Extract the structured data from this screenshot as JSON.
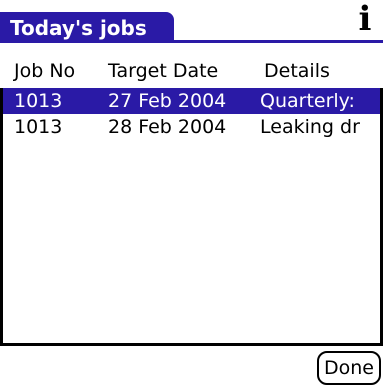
{
  "header": {
    "title": "Today's jobs",
    "info_icon": "info-icon",
    "info_glyph": "i",
    "accent_color": "#2a1aa6"
  },
  "table": {
    "columns": [
      "Job No",
      "Target Date",
      "Details"
    ],
    "rows": [
      {
        "job_no": "1013",
        "target_date": "27 Feb 2004",
        "details": "Quarterly:",
        "selected": true
      },
      {
        "job_no": "1013",
        "target_date": "28 Feb 2004",
        "details": "Leaking dr",
        "selected": false
      }
    ]
  },
  "footer": {
    "done_label": "Done"
  }
}
